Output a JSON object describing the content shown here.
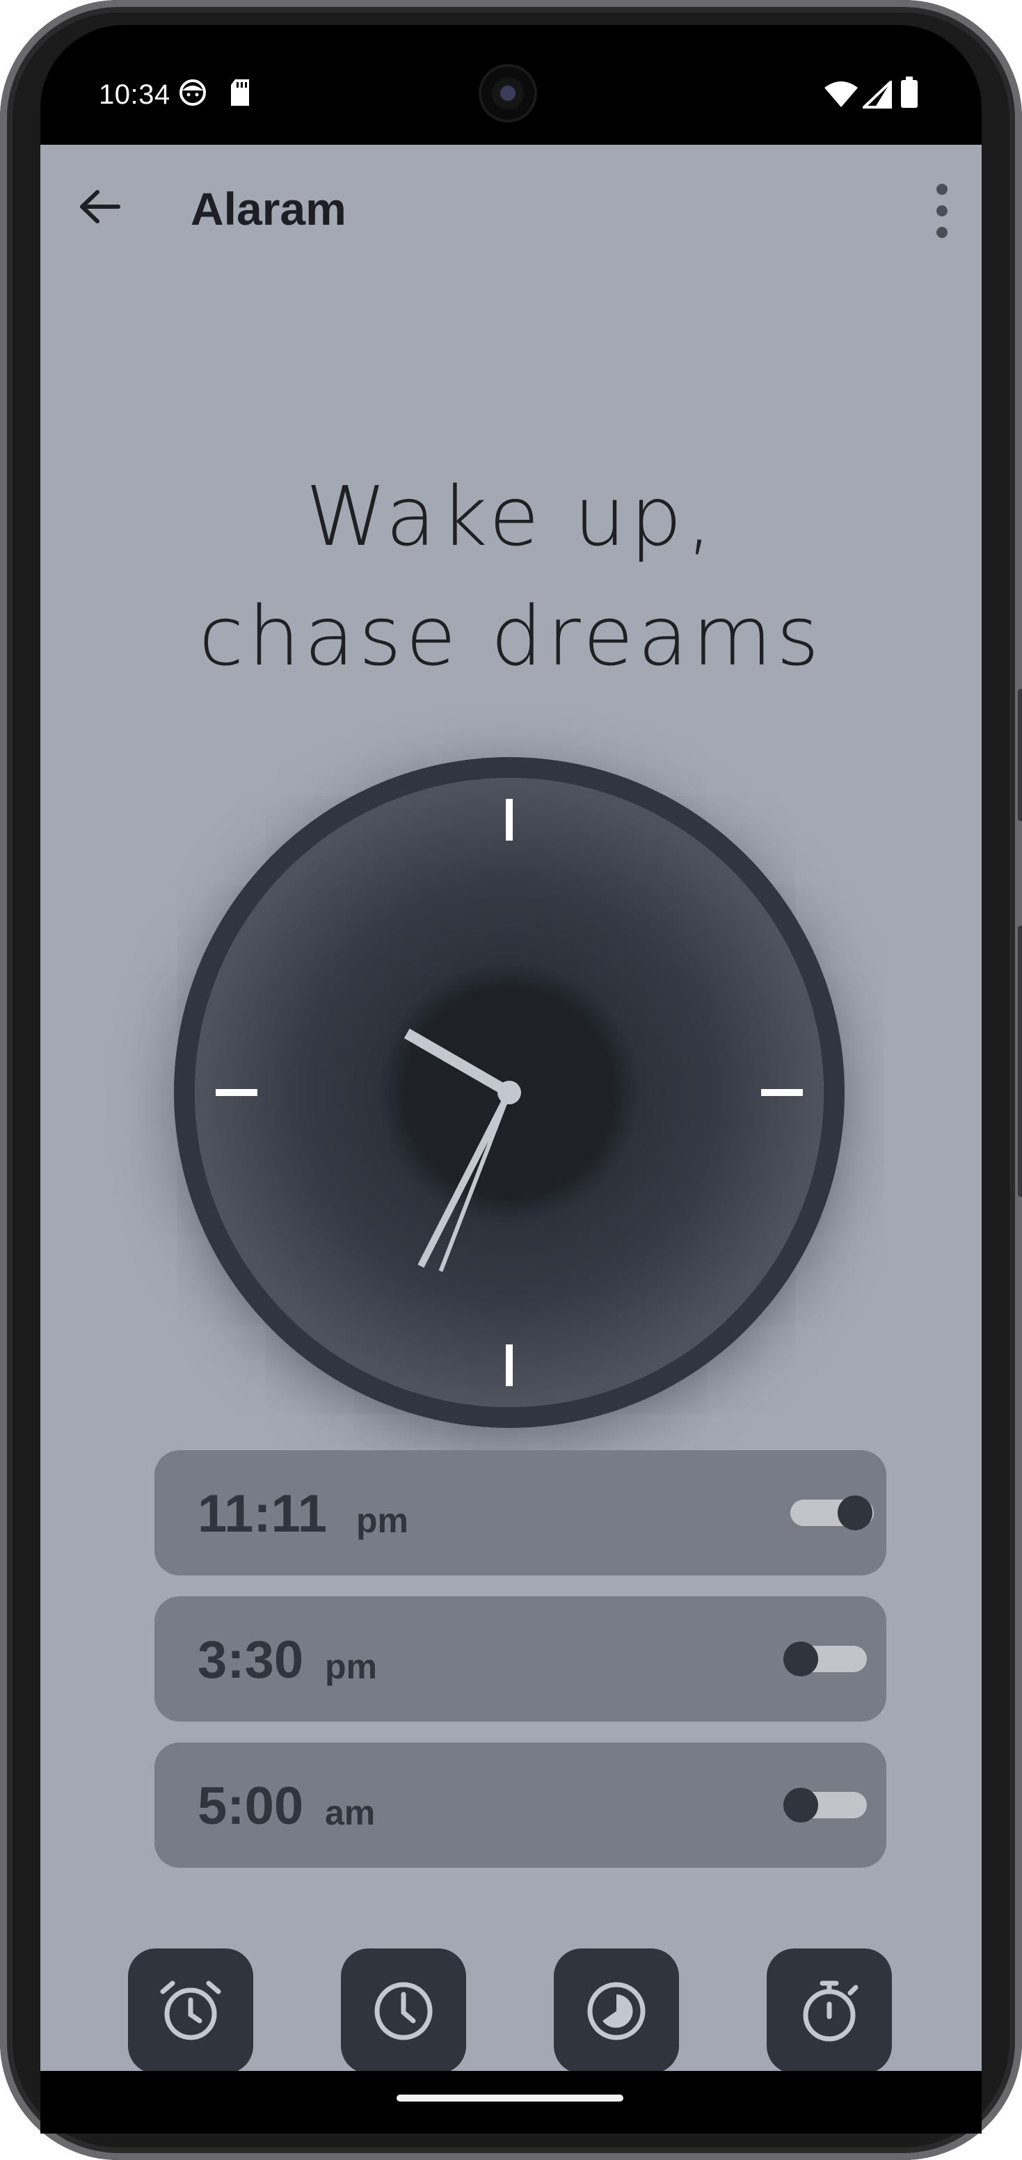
{
  "status_bar": {
    "time": "10:34",
    "icons": [
      "face-notification-icon",
      "sd-card-icon",
      "wifi-icon",
      "signal-icon",
      "battery-icon"
    ]
  },
  "app_bar": {
    "back_icon": "arrow-back-icon",
    "title": "Alaram",
    "menu_icon": "more-vert-icon"
  },
  "quote": {
    "line1": "Wake up,",
    "line2": "chase dreams"
  },
  "clock": {
    "hour_hand_angle_deg": 300,
    "minute_hand_angle_deg": 207,
    "second_hand_angle_deg": 201
  },
  "alarms": [
    {
      "time": "11:11",
      "period": "pm",
      "enabled": true
    },
    {
      "time": "3:30",
      "period": "pm",
      "enabled": false
    },
    {
      "time": "5:00",
      "period": "am",
      "enabled": false
    }
  ],
  "bottom_nav": [
    {
      "icon": "alarm-icon"
    },
    {
      "icon": "clock-icon"
    },
    {
      "icon": "timer-icon"
    },
    {
      "icon": "stopwatch-icon"
    }
  ],
  "colors": {
    "app_background": "#a3a8b3",
    "dark_accent": "#30343d",
    "card": "#787c86",
    "hand": "#c2c7d0"
  }
}
